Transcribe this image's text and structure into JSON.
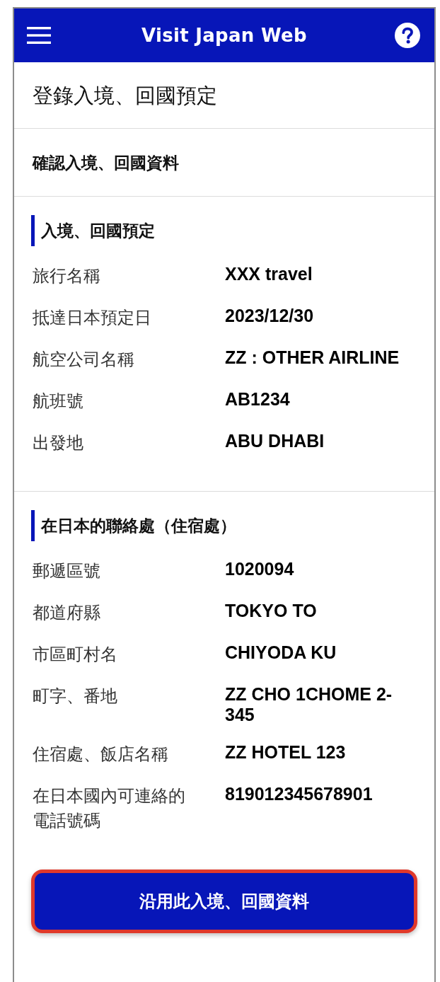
{
  "header": {
    "title": "Visit Japan Web"
  },
  "page_title": "登錄入境、回國預定",
  "subtitle": "確認入境、回國資料",
  "sections": [
    {
      "heading": "入境、回國預定",
      "rows": [
        {
          "label": "旅行名稱",
          "value": "XXX travel"
        },
        {
          "label": "抵達日本預定日",
          "value": "2023/12/30"
        },
        {
          "label": "航空公司名稱",
          "value": "ZZ : OTHER AIRLINE"
        },
        {
          "label": "航班號",
          "value": "AB1234"
        },
        {
          "label": "出發地",
          "value": "ABU DHABI"
        }
      ]
    },
    {
      "heading": "在日本的聯絡處（住宿處）",
      "rows": [
        {
          "label": "郵遞區號",
          "value": "1020094"
        },
        {
          "label": "都道府縣",
          "value": "TOKYO TO"
        },
        {
          "label": "市區町村名",
          "value": "CHIYODA KU"
        },
        {
          "label": "町字、番地",
          "value": "ZZ CHO 1CHOME 2-345"
        },
        {
          "label": "住宿處、飯店名稱",
          "value": "ZZ HOTEL 123"
        },
        {
          "label": "在日本國內可連絡的電話號碼",
          "value": "819012345678901"
        }
      ]
    }
  ],
  "button": {
    "label": "沿用此入境、回國資料",
    "highlighted": true
  }
}
